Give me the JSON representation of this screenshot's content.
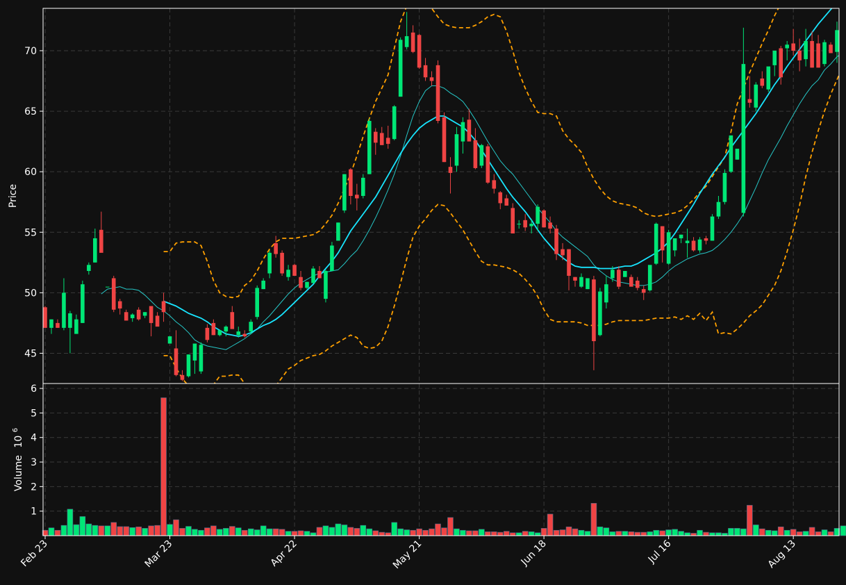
{
  "chart_data": {
    "type": "candlestick",
    "colors": {
      "up": "#00e676",
      "down": "#ef4444",
      "ma_fast": "#26c6c6",
      "ma_slow": "#18e5ff",
      "bands": "#ffa000",
      "background": "#111111",
      "grid": "#3a3a3a",
      "frame": "#ffffff"
    },
    "price_panel": {
      "ylabel": "Price",
      "ylim": [
        42.5,
        73.5
      ],
      "yticks": [
        45,
        50,
        55,
        60,
        65,
        70
      ],
      "grid": true
    },
    "volume_panel": {
      "ylabel": "Volume",
      "scale_label": "10",
      "scale_exponent": "6",
      "ylim": [
        0,
        6.2
      ],
      "yticks": [
        1,
        2,
        3,
        4,
        5,
        6
      ],
      "grid": true
    },
    "x_ticks": [
      {
        "label": "Feb 23",
        "index": 0
      },
      {
        "label": "Mar 23",
        "index": 20
      },
      {
        "label": "Apr 22",
        "index": 40
      },
      {
        "label": "May 21",
        "index": 60
      },
      {
        "label": "Jun 18",
        "index": 80
      },
      {
        "label": "Jul 16",
        "index": 100
      },
      {
        "label": "Aug 13",
        "index": 120
      }
    ],
    "candles_ohlc": [
      [
        48.8,
        48.9,
        47.1,
        47.1
      ],
      [
        47.1,
        47.8,
        46.6,
        47.8
      ],
      [
        47.5,
        47.8,
        47.1,
        47.1
      ],
      [
        47.1,
        51.2,
        46.9,
        50.0
      ],
      [
        47.1,
        48.5,
        45.0,
        48.3
      ],
      [
        46.6,
        48.2,
        46.6,
        47.8
      ],
      [
        47.5,
        51.0,
        47.5,
        50.7
      ],
      [
        51.8,
        52.5,
        51.5,
        52.3
      ],
      [
        52.5,
        55.3,
        52.5,
        54.5
      ],
      [
        55.2,
        56.7,
        53.6,
        53.3
      ],
      [
        50.5,
        50.5,
        50.5,
        50.5
      ],
      [
        51.2,
        51.4,
        48.4,
        48.6
      ],
      [
        49.3,
        49.5,
        48.2,
        48.7
      ],
      [
        48.4,
        48.6,
        47.7,
        47.7
      ],
      [
        47.9,
        48.3,
        47.6,
        48.2
      ],
      [
        48.6,
        48.8,
        47.7,
        47.8
      ],
      [
        48.1,
        48.4,
        47.9,
        48.4
      ],
      [
        48.9,
        48.9,
        46.4,
        47.5
      ],
      [
        48.1,
        48.4,
        47.5,
        47.2
      ],
      [
        49.3,
        50.0,
        47.6,
        48.4
      ],
      [
        45.8,
        46.4,
        45.8,
        46.4
      ],
      [
        45.4,
        46.9,
        43.1,
        43.2
      ],
      [
        43.2,
        43.6,
        42.7,
        42.8
      ],
      [
        43.1,
        44.9,
        43.0,
        44.9
      ],
      [
        44.4,
        45.8,
        43.3,
        45.8
      ],
      [
        43.5,
        45.9,
        43.3,
        45.7
      ],
      [
        47.1,
        47.4,
        45.9,
        46.1
      ],
      [
        47.5,
        47.8,
        46.5,
        46.5
      ],
      [
        46.5,
        46.9,
        46.4,
        46.9
      ],
      [
        46.8,
        47.3,
        46.4,
        47.2
      ],
      [
        48.4,
        48.9,
        47.1,
        47.0
      ],
      [
        46.5,
        47.2,
        46.3,
        46.8
      ],
      [
        46.6,
        46.9,
        46.3,
        46.4
      ],
      [
        46.8,
        47.8,
        46.6,
        47.6
      ],
      [
        48.0,
        50.6,
        47.8,
        50.4
      ],
      [
        50.3,
        51.2,
        50.3,
        51.0
      ],
      [
        51.6,
        53.5,
        51.2,
        53.3
      ],
      [
        54.1,
        54.7,
        52.9,
        53.2
      ],
      [
        53.3,
        53.5,
        51.4,
        51.6
      ],
      [
        51.3,
        52.3,
        51.0,
        51.9
      ],
      [
        52.3,
        52.4,
        51.4,
        51.4
      ],
      [
        51.3,
        51.8,
        50.2,
        50.4
      ],
      [
        50.4,
        50.9,
        50.3,
        50.9
      ],
      [
        50.8,
        52.2,
        50.8,
        52.0
      ],
      [
        51.8,
        52.2,
        51.2,
        51.2
      ],
      [
        49.5,
        51.9,
        49.2,
        51.8
      ],
      [
        51.8,
        54.2,
        51.8,
        53.9
      ],
      [
        54.3,
        55.8,
        54.3,
        55.8
      ],
      [
        56.8,
        59.8,
        56.6,
        59.8
      ],
      [
        60.2,
        60.3,
        57.3,
        58.0
      ],
      [
        58.1,
        59.0,
        56.8,
        57.8
      ],
      [
        58.0,
        59.8,
        57.8,
        59.5
      ],
      [
        59.8,
        64.4,
        59.8,
        64.2
      ],
      [
        63.3,
        63.6,
        61.4,
        62.4
      ],
      [
        63.2,
        63.7,
        62.2,
        62.2
      ],
      [
        62.8,
        63.8,
        61.9,
        62.3
      ],
      [
        62.7,
        65.5,
        62.6,
        65.4
      ],
      [
        66.2,
        71.1,
        66.2,
        70.9
      ],
      [
        70.3,
        73.2,
        70.1,
        71.2
      ],
      [
        71.5,
        72.1,
        69.8,
        69.9
      ],
      [
        71.3,
        71.4,
        68.5,
        68.6
      ],
      [
        68.8,
        69.4,
        67.5,
        67.8
      ],
      [
        67.8,
        68.3,
        67.1,
        67.5
      ],
      [
        68.8,
        69.2,
        64.0,
        64.2
      ],
      [
        64.5,
        64.9,
        60.8,
        60.8
      ],
      [
        60.4,
        61.2,
        58.2,
        59.9
      ],
      [
        60.5,
        63.7,
        60.0,
        63.1
      ],
      [
        62.5,
        64.5,
        61.5,
        64.1
      ],
      [
        64.3,
        65.2,
        62.6,
        62.5
      ],
      [
        62.6,
        63.6,
        60.2,
        60.3
      ],
      [
        60.5,
        62.3,
        60.3,
        62.2
      ],
      [
        62.1,
        62.3,
        59.0,
        59.1
      ],
      [
        59.3,
        59.8,
        58.2,
        58.6
      ],
      [
        58.3,
        58.4,
        56.9,
        57.4
      ],
      [
        57.8,
        58.1,
        57.2,
        57.2
      ],
      [
        57.0,
        57.4,
        55.2,
        54.9
      ],
      [
        55.7,
        56.0,
        55.3,
        55.7
      ],
      [
        56.0,
        56.5,
        55.1,
        55.4
      ],
      [
        55.5,
        56.1,
        54.9,
        55.7
      ],
      [
        55.7,
        57.3,
        55.1,
        57.1
      ],
      [
        56.8,
        56.9,
        55.4,
        55.4
      ],
      [
        55.8,
        56.3,
        54.9,
        55.3
      ],
      [
        55.3,
        55.6,
        52.7,
        53.2
      ],
      [
        53.6,
        54.1,
        52.7,
        53.1
      ],
      [
        53.6,
        53.6,
        50.2,
        51.4
      ],
      [
        51.3,
        51.3,
        50.5,
        51.0
      ],
      [
        50.5,
        51.6,
        50.4,
        51.3
      ],
      [
        50.3,
        51.2,
        50.3,
        51.2
      ],
      [
        51.1,
        51.4,
        43.6,
        46.0
      ],
      [
        46.5,
        50.4,
        46.4,
        50.1
      ],
      [
        49.2,
        51.4,
        48.7,
        50.7
      ],
      [
        51.2,
        52.2,
        50.9,
        51.9
      ],
      [
        51.9,
        52.2,
        50.3,
        50.5
      ],
      [
        51.3,
        51.8,
        51.3,
        51.8
      ],
      [
        51.3,
        51.5,
        50.6,
        50.5
      ],
      [
        51.0,
        51.3,
        50.2,
        50.4
      ],
      [
        50.3,
        50.6,
        49.4,
        50.0
      ],
      [
        50.2,
        52.0,
        50.1,
        52.3
      ],
      [
        52.4,
        55.8,
        52.3,
        55.7
      ],
      [
        55.5,
        55.5,
        52.5,
        53.5
      ],
      [
        52.4,
        55.2,
        52.3,
        55.0
      ],
      [
        53.5,
        54.5,
        53.0,
        54.5
      ],
      [
        54.5,
        54.8,
        54.1,
        54.8
      ],
      [
        54.1,
        55.3,
        52.9,
        54.3
      ],
      [
        54.3,
        54.6,
        53.4,
        53.5
      ],
      [
        53.5,
        54.6,
        53.3,
        54.4
      ],
      [
        54.5,
        54.7,
        54.0,
        54.3
      ],
      [
        54.3,
        56.5,
        54.3,
        56.3
      ],
      [
        56.3,
        58.0,
        56.1,
        57.5
      ],
      [
        57.5,
        60.2,
        57.3,
        59.9
      ],
      [
        60.0,
        63.0,
        59.9,
        63.0
      ],
      [
        61.0,
        61.8,
        61.0,
        61.9
      ],
      [
        56.6,
        71.9,
        56.3,
        68.9
      ],
      [
        66.0,
        67.9,
        65.3,
        65.7
      ],
      [
        65.3,
        67.4,
        65.0,
        67.2
      ],
      [
        67.7,
        68.3,
        66.9,
        67.1
      ],
      [
        66.8,
        68.2,
        66.6,
        68.7
      ],
      [
        68.8,
        69.2,
        67.9,
        70.0
      ],
      [
        70.2,
        70.4,
        67.2,
        67.8
      ],
      [
        70.2,
        70.8,
        69.2,
        70.5
      ],
      [
        70.6,
        71.8,
        69.6,
        70.0
      ],
      [
        70.0,
        71.0,
        68.3,
        69.2
      ],
      [
        69.3,
        71.8,
        68.7,
        70.8
      ],
      [
        70.8,
        71.6,
        68.6,
        68.6
      ],
      [
        70.6,
        71.3,
        68.6,
        68.6
      ],
      [
        68.9,
        70.9,
        68.7,
        70.7
      ],
      [
        70.5,
        70.7,
        69.8,
        69.8
      ],
      [
        69.9,
        72.4,
        69.0,
        71.7
      ]
    ],
    "volume": [
      0.22,
      0.32,
      0.22,
      0.42,
      1.08,
      0.45,
      0.78,
      0.48,
      0.42,
      0.4,
      0.4,
      0.54,
      0.37,
      0.37,
      0.33,
      0.36,
      0.3,
      0.4,
      0.42,
      5.62,
      0.46,
      0.65,
      0.3,
      0.38,
      0.26,
      0.22,
      0.32,
      0.4,
      0.26,
      0.3,
      0.38,
      0.32,
      0.22,
      0.28,
      0.24,
      0.4,
      0.28,
      0.28,
      0.26,
      0.18,
      0.18,
      0.2,
      0.18,
      0.12,
      0.34,
      0.4,
      0.34,
      0.48,
      0.44,
      0.34,
      0.3,
      0.42,
      0.28,
      0.2,
      0.14,
      0.12,
      0.54,
      0.28,
      0.24,
      0.22,
      0.28,
      0.22,
      0.28,
      0.48,
      0.32,
      0.74,
      0.28,
      0.22,
      0.2,
      0.2,
      0.26,
      0.16,
      0.16,
      0.14,
      0.18,
      0.12,
      0.12,
      0.18,
      0.16,
      0.12,
      0.3,
      0.88,
      0.22,
      0.24,
      0.36,
      0.28,
      0.22,
      0.18,
      1.32,
      0.36,
      0.32,
      0.16,
      0.18,
      0.18,
      0.16,
      0.14,
      0.14,
      0.16,
      0.22,
      0.2,
      0.24,
      0.26,
      0.18,
      0.12,
      0.1,
      0.22,
      0.14,
      0.12,
      0.12,
      0.1,
      0.3,
      0.3,
      0.28,
      1.24,
      0.44,
      0.28,
      0.22,
      0.2,
      0.36,
      0.22,
      0.26,
      0.16,
      0.18,
      0.34,
      0.16,
      0.24,
      0.16,
      0.3,
      0.4
    ],
    "ma_fast": [
      null,
      null,
      null,
      null,
      null,
      null,
      null,
      null,
      null,
      49.9,
      50.3,
      50.4,
      50.5,
      50.3,
      50.3,
      50.2,
      49.8,
      49.3,
      48.8,
      48.5,
      48.1,
      47.6,
      47.2,
      46.7,
      46.1,
      45.8,
      45.6,
      45.5,
      45.4,
      45.3,
      45.6,
      45.9,
      46.2,
      46.6,
      47.0,
      47.6,
      48.1,
      48.7,
      49.3,
      49.9,
      50.4,
      50.8,
      51.1,
      51.4,
      51.6,
      51.7,
      51.8,
      51.9,
      52.4,
      53.0,
      53.5,
      54.3,
      55.2,
      56.2,
      57.3,
      58.5,
      59.8,
      61.3,
      63.0,
      64.6,
      65.8,
      66.7,
      67.1,
      67.1,
      66.9,
      66.5,
      66.2,
      65.8,
      65.1,
      64.3,
      63.4,
      62.5,
      61.7,
      60.9,
      60.3,
      59.8,
      59.1,
      58.4,
      57.7,
      57.0,
      56.4,
      55.8,
      55.1,
      54.6,
      54.2,
      53.8,
      53.4,
      53.0,
      52.3,
      51.8,
      51.4,
      51.1,
      50.9,
      50.8,
      50.7,
      50.6,
      50.6,
      50.7,
      50.9,
      51.3,
      51.8,
      52.2,
      52.5,
      52.8,
      53.0,
      53.2,
      53.3,
      53.5,
      53.9,
      54.4,
      55.0,
      55.7,
      56.5,
      57.6,
      58.7,
      59.9,
      61.0,
      61.9,
      62.8,
      63.8,
      64.7,
      65.6,
      66.4,
      67.1,
      67.6,
      68.4,
      68.9,
      69.5,
      69.8
    ],
    "ma_slow": [
      null,
      null,
      null,
      null,
      null,
      null,
      null,
      null,
      null,
      null,
      null,
      null,
      null,
      null,
      null,
      null,
      null,
      null,
      null,
      49.3,
      49.1,
      48.9,
      48.6,
      48.3,
      48.1,
      47.9,
      47.6,
      47.2,
      46.9,
      46.6,
      46.5,
      46.4,
      46.5,
      46.7,
      47.0,
      47.3,
      47.5,
      47.8,
      48.2,
      48.7,
      49.2,
      49.7,
      50.2,
      50.7,
      51.4,
      52.0,
      52.6,
      53.3,
      54.2,
      55.1,
      55.8,
      56.5,
      57.2,
      57.9,
      58.8,
      59.7,
      60.6,
      61.5,
      62.3,
      63.0,
      63.6,
      64.0,
      64.3,
      64.6,
      64.6,
      64.3,
      64.0,
      63.7,
      63.2,
      62.6,
      61.8,
      61.0,
      60.2,
      59.4,
      58.6,
      57.9,
      57.3,
      56.7,
      56.0,
      55.2,
      54.5,
      53.9,
      53.3,
      52.9,
      52.5,
      52.2,
      52.1,
      52.1,
      52.1,
      52.0,
      52.0,
      52.0,
      52.1,
      52.2,
      52.2,
      52.4,
      52.7,
      53.0,
      53.3,
      53.7,
      54.2,
      54.9,
      55.7,
      56.5,
      57.3,
      58.2,
      59.0,
      59.8,
      60.5,
      61.2,
      62.0,
      62.7,
      63.4,
      64.1,
      64.8,
      65.6,
      66.4,
      67.2,
      67.9,
      68.7,
      69.4,
      70.1,
      70.8,
      71.5,
      72.2,
      72.8,
      73.4,
      74.0,
      74.6
    ],
    "band_upper": [
      null,
      null,
      null,
      null,
      null,
      null,
      null,
      null,
      null,
      null,
      null,
      null,
      null,
      null,
      null,
      null,
      null,
      null,
      null,
      53.4,
      53.4,
      54.1,
      54.2,
      54.2,
      54.2,
      53.9,
      52.6,
      51.0,
      50.0,
      49.7,
      49.6,
      49.7,
      50.6,
      51.0,
      51.8,
      52.8,
      53.6,
      54.2,
      54.5,
      54.5,
      54.5,
      54.6,
      54.7,
      54.8,
      55.1,
      55.7,
      56.4,
      57.4,
      58.6,
      59.8,
      61.3,
      62.9,
      64.4,
      65.8,
      66.9,
      68.0,
      70.2,
      72.4,
      73.7,
      74.6,
      74.6,
      74.0,
      73.5,
      72.8,
      72.2,
      72.0,
      71.9,
      71.9,
      71.9,
      72.1,
      72.4,
      72.8,
      73.0,
      72.8,
      71.6,
      70.0,
      68.2,
      66.9,
      65.8,
      64.9,
      64.8,
      64.8,
      64.6,
      63.4,
      62.7,
      62.2,
      61.6,
      60.4,
      59.4,
      58.6,
      58.0,
      57.6,
      57.4,
      57.3,
      57.2,
      57.0,
      56.6,
      56.4,
      56.3,
      56.4,
      56.5,
      56.6,
      56.8,
      57.2,
      57.7,
      58.3,
      58.8,
      59.6,
      60.4,
      61.2,
      63.3,
      65.6,
      66.9,
      68.2,
      69.4,
      70.6,
      71.7,
      72.9,
      73.9,
      74.8,
      75.6,
      76.4,
      77.2,
      77.9,
      78.5,
      79.1,
      79.7,
      80.2,
      80.8
    ],
    "band_lower": [
      null,
      null,
      null,
      null,
      null,
      null,
      null,
      null,
      null,
      null,
      null,
      null,
      null,
      null,
      null,
      null,
      null,
      null,
      null,
      44.8,
      44.8,
      43.8,
      42.9,
      42.3,
      42.0,
      41.8,
      41.9,
      42.4,
      43.1,
      43.1,
      43.2,
      43.2,
      42.5,
      42.1,
      41.8,
      41.8,
      42.1,
      42.3,
      43.0,
      43.7,
      44.0,
      44.4,
      44.6,
      44.8,
      44.9,
      45.2,
      45.6,
      45.9,
      46.2,
      46.5,
      46.3,
      45.6,
      45.4,
      45.5,
      46.0,
      47.2,
      48.9,
      50.8,
      52.8,
      54.6,
      55.5,
      56.1,
      56.8,
      57.3,
      57.2,
      56.6,
      55.9,
      55.2,
      54.3,
      53.4,
      52.6,
      52.3,
      52.3,
      52.2,
      52.1,
      51.9,
      51.6,
      51.1,
      50.5,
      49.7,
      48.6,
      47.8,
      47.6,
      47.6,
      47.6,
      47.6,
      47.5,
      47.3,
      47.3,
      47.3,
      47.4,
      47.6,
      47.7,
      47.7,
      47.7,
      47.7,
      47.7,
      47.8,
      47.9,
      47.9,
      47.9,
      48.0,
      47.8,
      48.1,
      47.8,
      48.3,
      47.7,
      48.4,
      46.6,
      46.7,
      46.6,
      47.0,
      47.5,
      48.1,
      48.5,
      49.0,
      49.8,
      50.6,
      51.8,
      53.4,
      55.2,
      57.2,
      59.6,
      61.6,
      63.4,
      65.0,
      66.4,
      67.6,
      68.8
    ]
  }
}
